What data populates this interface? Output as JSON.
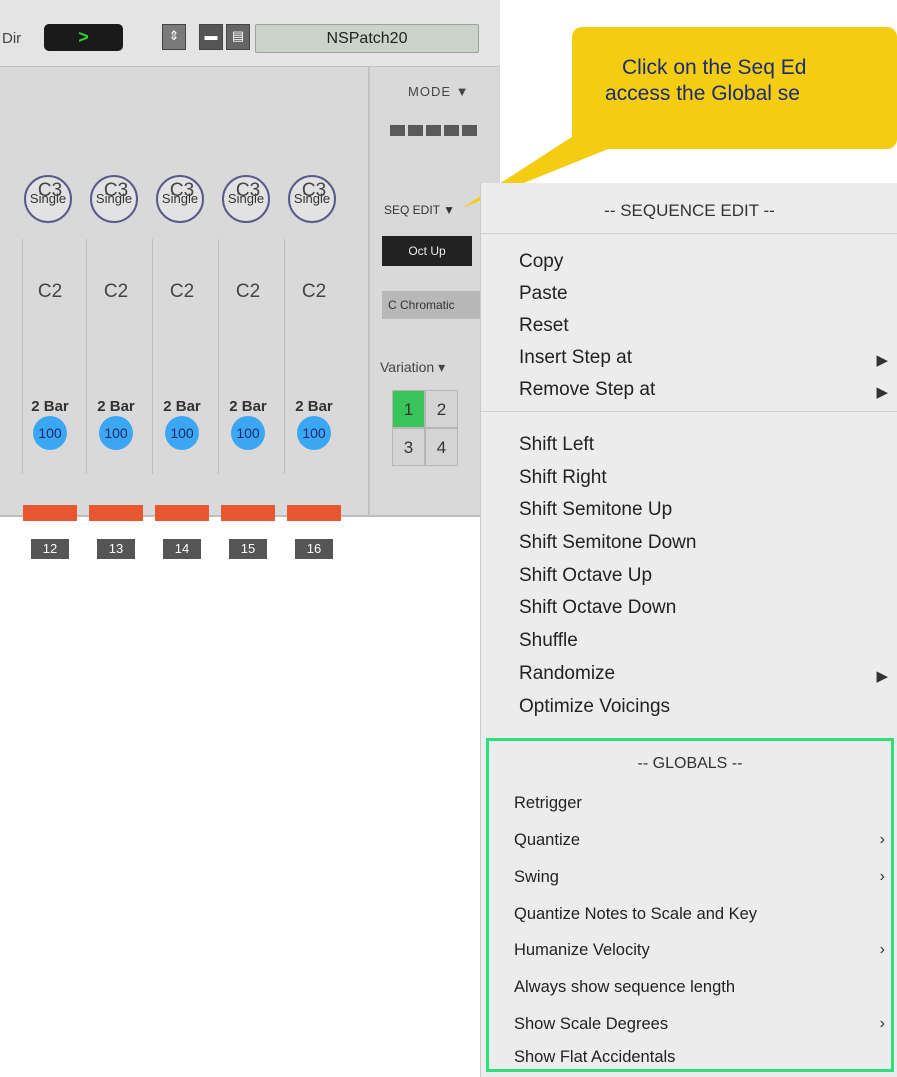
{
  "header": {
    "dir_label": "Dir",
    "dir_button": ">",
    "patch_name": "NSPatch20"
  },
  "tracks": {
    "columns": [
      {
        "mode": "Single",
        "note_high": "C3",
        "note_low": "C2",
        "length": "2 Bar",
        "velocity": "100",
        "step": "12"
      },
      {
        "mode": "Single",
        "note_high": "C3",
        "note_low": "C2",
        "length": "2 Bar",
        "velocity": "100",
        "step": "13"
      },
      {
        "mode": "Single",
        "note_high": "C3",
        "note_low": "C2",
        "length": "2 Bar",
        "velocity": "100",
        "step": "14"
      },
      {
        "mode": "Single",
        "note_high": "C3",
        "note_low": "C2",
        "length": "2 Bar",
        "velocity": "100",
        "step": "15"
      },
      {
        "mode": "Single",
        "note_high": "C3",
        "note_low": "C2",
        "length": "2 Bar",
        "velocity": "100",
        "step": "16"
      }
    ]
  },
  "side": {
    "mode_label": "MODE ▼",
    "seq_edit_label": "SEQ EDIT ▼",
    "oct_up": "Oct Up",
    "scale": "C Chromatic",
    "variation_label": "Variation ▾",
    "variations": [
      "1",
      "2",
      "3",
      "4"
    ]
  },
  "callout": {
    "line1": "Click on the Seq Ed",
    "line2": "access the Global se"
  },
  "menu": {
    "header": "-- SEQUENCE EDIT --",
    "group1": [
      "Copy",
      "Paste",
      "Reset",
      "Insert Step at",
      "Remove Step at"
    ],
    "group2": [
      "Shift Left",
      "Shift Right",
      "Shift Semitone Up",
      "Shift Semitone Down",
      "Shift Octave Up",
      "Shift Octave Down",
      "Shuffle",
      "Randomize",
      "Optimize Voicings"
    ]
  },
  "globals": {
    "header": "-- GLOBALS --",
    "items": [
      "Retrigger",
      "Quantize",
      "Swing",
      "Quantize Notes to Scale and Key",
      "Humanize Velocity",
      "Always show sequence length",
      "Show Scale Degrees",
      "Show Flat Accidentals"
    ]
  },
  "colors": {
    "highlight_border": "#2de07c",
    "callout": "#f4cc12",
    "velocity": "#3ba6f2",
    "active_variation": "#39c45b"
  }
}
